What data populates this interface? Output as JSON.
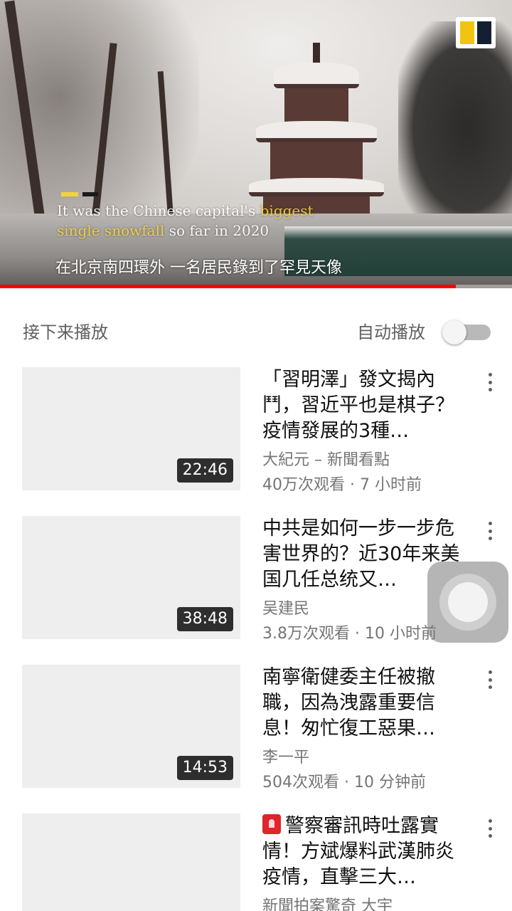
{
  "player": {
    "subtitle_en_prefix": "It was the Chinese capital's ",
    "subtitle_en_highlight_1": "biggest",
    "subtitle_en_highlight_2": "single snowfall",
    "subtitle_en_suffix": " so far in 2020",
    "subtitle_zh": "在北京南四環外 一名居民錄到了罕見天像",
    "progress": 0.89,
    "accent_color": "#ff0000",
    "logo_icon": "scmp-logo"
  },
  "up_next": {
    "title": "接下来播放",
    "autoplay_label": "自动播放",
    "autoplay_on": false
  },
  "videos": [
    {
      "title": "「習明澤」發文揭內鬥，習近平也是棋子？疫情發展的3種…",
      "channel": "大紀元 – 新聞看點",
      "meta": "40万次观看 · 7 小时前",
      "duration": "22:46"
    },
    {
      "title": "中共是如何一步一步危害世界的？近30年来美国几任总统又…",
      "channel": "吴建民",
      "meta": "3.8万次观看 · 10 小时前",
      "duration": "38:48"
    },
    {
      "title": "南寧衛健委主任被撤職，因為洩露重要信息！匆忙復工惡果…",
      "channel": "李一平",
      "meta": "504次观看 · 10 分钟前",
      "duration": "14:53"
    },
    {
      "title": "警察審訊時吐露實情！方斌爆料武漢肺炎疫情，直擊三大…",
      "channel": "新聞拍案驚奇 大宇",
      "meta": "",
      "duration": ""
    }
  ]
}
